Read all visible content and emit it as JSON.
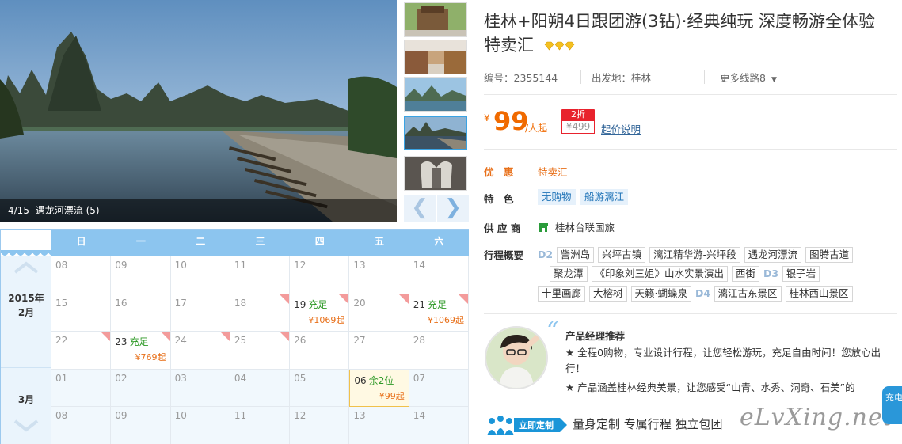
{
  "gallery": {
    "caption_index": "4/15",
    "caption_text": "遇龙河漂流 (5)",
    "prev_icon": "chevron-left-icon",
    "next_icon": "chevron-right-icon"
  },
  "calendar": {
    "weekdays": [
      "日",
      "一",
      "二",
      "三",
      "四",
      "五",
      "六"
    ],
    "months": [
      {
        "year_label": "2015年",
        "month_label": "2月"
      },
      {
        "month_label": "3月"
      }
    ],
    "rows": [
      [
        {
          "d": "08"
        },
        {
          "d": "09"
        },
        {
          "d": "10"
        },
        {
          "d": "11"
        },
        {
          "d": "12"
        },
        {
          "d": "13"
        },
        {
          "d": "14"
        }
      ],
      [
        {
          "d": "15"
        },
        {
          "d": "16"
        },
        {
          "d": "17"
        },
        {
          "d": "18",
          "corner": true
        },
        {
          "d": "19",
          "status": "充足",
          "price": "¥1069起",
          "corner": true,
          "on": true
        },
        {
          "d": "20",
          "corner": true
        },
        {
          "d": "21",
          "status": "充足",
          "price": "¥1069起",
          "corner": true,
          "on": true
        }
      ],
      [
        {
          "d": "22",
          "corner": true
        },
        {
          "d": "23",
          "status": "充足",
          "price": "¥769起",
          "corner": true,
          "on": true
        },
        {
          "d": "24",
          "corner": true
        },
        {
          "d": "25",
          "corner": true
        },
        {
          "d": "26"
        },
        {
          "d": "27"
        },
        {
          "d": "28"
        }
      ],
      [
        {
          "d": "01",
          "mar": true
        },
        {
          "d": "02",
          "mar": true
        },
        {
          "d": "03",
          "mar": true
        },
        {
          "d": "04",
          "mar": true
        },
        {
          "d": "05",
          "mar": true
        },
        {
          "d": "06",
          "status": "余2位",
          "price": "¥99起",
          "sel": true,
          "on": true,
          "orange": true
        },
        {
          "d": "07",
          "mar": true
        }
      ],
      [
        {
          "d": "08",
          "mar": true
        },
        {
          "d": "09",
          "mar": true
        },
        {
          "d": "10",
          "mar": true
        },
        {
          "d": "11",
          "mar": true
        },
        {
          "d": "12",
          "mar": true
        },
        {
          "d": "13",
          "mar": true
        },
        {
          "d": "14",
          "mar": true
        }
      ]
    ]
  },
  "product": {
    "title": "桂林+阳朔4日跟团游(3钻)·经典纯玩 深度畅游全体验 特卖汇",
    "code_label": "编号：2355144",
    "departure_label": "出发地：桂林",
    "more_routes": "更多线路8",
    "currency": "¥",
    "price": "99",
    "per_person": "/人起",
    "discount": "2折",
    "original_price": "¥499",
    "price_note": "起价说明",
    "promo_label": "优　惠",
    "promo_value": "特卖汇",
    "feature_label": "特　色",
    "features": [
      "无购物",
      "船游漓江"
    ],
    "supplier_label": "供 应 商",
    "supplier": "桂林台联国旅",
    "itinerary_label": "行程概要",
    "itinerary": [
      {
        "day": "D2",
        "spots": [
          "訾洲岛",
          "兴坪古镇",
          "漓江精华游-兴坪段",
          "遇龙河漂流",
          "图腾古道"
        ]
      },
      {
        "day": "",
        "spots": [
          "聚龙潭",
          "《印象刘三姐》山水实景演出",
          "西街"
        ]
      },
      {
        "day": "D3",
        "spots": [
          "银子岩"
        ]
      },
      {
        "day": "",
        "spots": [
          "十里画廊",
          "大榕树",
          "天籁·蝴蝶泉"
        ]
      },
      {
        "day": "D4",
        "spots": [
          "漓江古东景区",
          "桂林西山景区"
        ]
      }
    ]
  },
  "recommend": {
    "title": "产品经理推荐",
    "line1": "★ 全程0购物，专业设计行程，让您轻松游玩，充足自由时间！您放心出行！",
    "line2": "★ 产品涵盖桂林经典美景，让您感受“山青、水秀、洞奇、石美”的"
  },
  "bottom": {
    "badge": "立即定制",
    "slogan": "量身定制 专属行程 独立包团",
    "watermark": "eLvXing.net",
    "float_button": "充电"
  },
  "colors": {
    "accent_orange": "#f06a00",
    "calendar_blue": "#8cc5ef",
    "discount_red": "#e8222d",
    "tag_blue": "#1f73b7",
    "status_green": "#2f9a28"
  }
}
